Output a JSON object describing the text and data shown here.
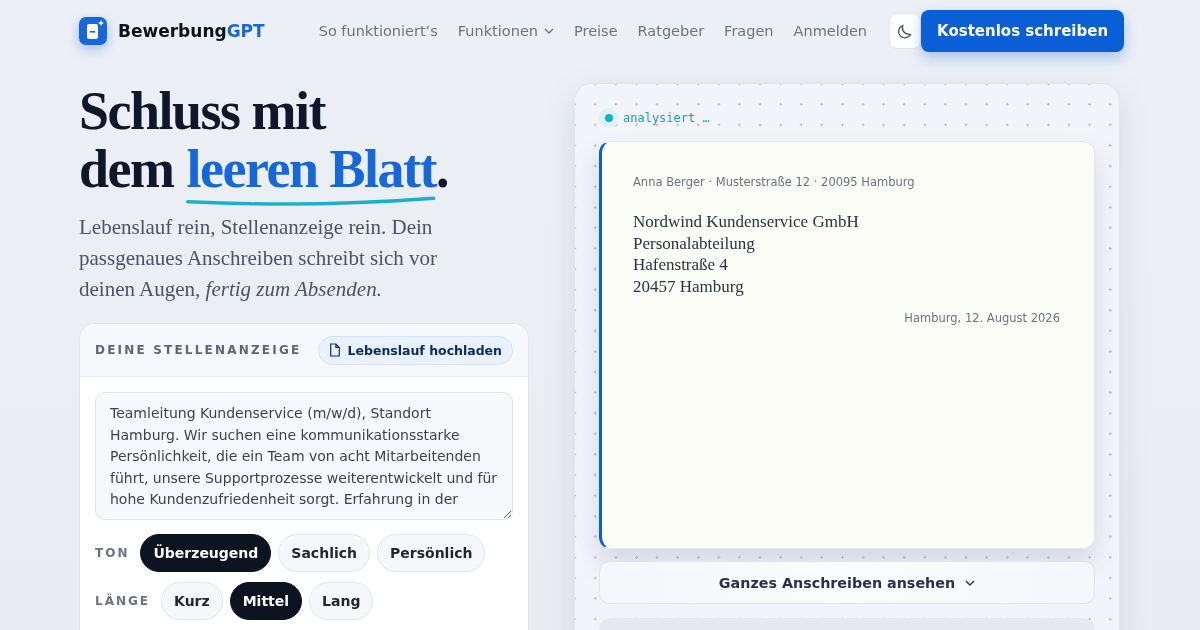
{
  "brand": {
    "name": "Bewerbung",
    "accent": "GPT"
  },
  "nav": [
    {
      "label": "So funktioniert’s",
      "dropdown": false
    },
    {
      "label": "Funktionen",
      "dropdown": true
    },
    {
      "label": "Preise",
      "dropdown": false
    },
    {
      "label": "Ratgeber",
      "dropdown": false
    },
    {
      "label": "Fragen",
      "dropdown": false
    },
    {
      "label": "Anmelden",
      "dropdown": false
    }
  ],
  "cta": "Kostenlos schreiben",
  "hero": {
    "line1": "Schluss mit",
    "line2_prefix": "dem",
    "highlight": "leeren Blatt",
    "suffix": ".",
    "lead": "Lebenslauf rein, Stellenanzeige rein. Dein passgenaues Anschreiben schreibt sich vor deinen Augen, *fertig zum Absenden.*"
  },
  "form": {
    "heading": "DEINE STELLENANZEIGE",
    "upload": "Lebenslauf hochladen",
    "job_ad": "Teamleitung Kundenservice (m/w/d), Standort Hamburg. Wir suchen eine kommunikationsstarke Persönlichkeit, die ein Team von acht Mitarbeitenden führt, unsere Supportprozesse weiterentwickelt und für hohe Kundenzufriedenheit sorgt. Erfahrung in der",
    "groups": [
      {
        "label": "TON",
        "options": [
          {
            "label": "Überzeugend",
            "selected": true
          },
          {
            "label": "Sachlich",
            "selected": false
          },
          {
            "label": "Persönlich",
            "selected": false
          }
        ]
      },
      {
        "label": "LÄNGE",
        "options": [
          {
            "label": "Kurz",
            "selected": false
          },
          {
            "label": "Mittel",
            "selected": true
          },
          {
            "label": "Lang",
            "selected": false
          }
        ]
      }
    ]
  },
  "preview": {
    "status": "analysiert …",
    "sender": "Anna Berger · Musterstraße 12 · 20095 Hamburg",
    "recipient": [
      "Nordwind Kundenservice GmbH",
      "Personalabteilung",
      "Hafenstraße 4",
      "20457 Hamburg"
    ],
    "date": "Hamburg, 12. August 2026",
    "expand": "Ganzes Anschreiben ansehen"
  }
}
